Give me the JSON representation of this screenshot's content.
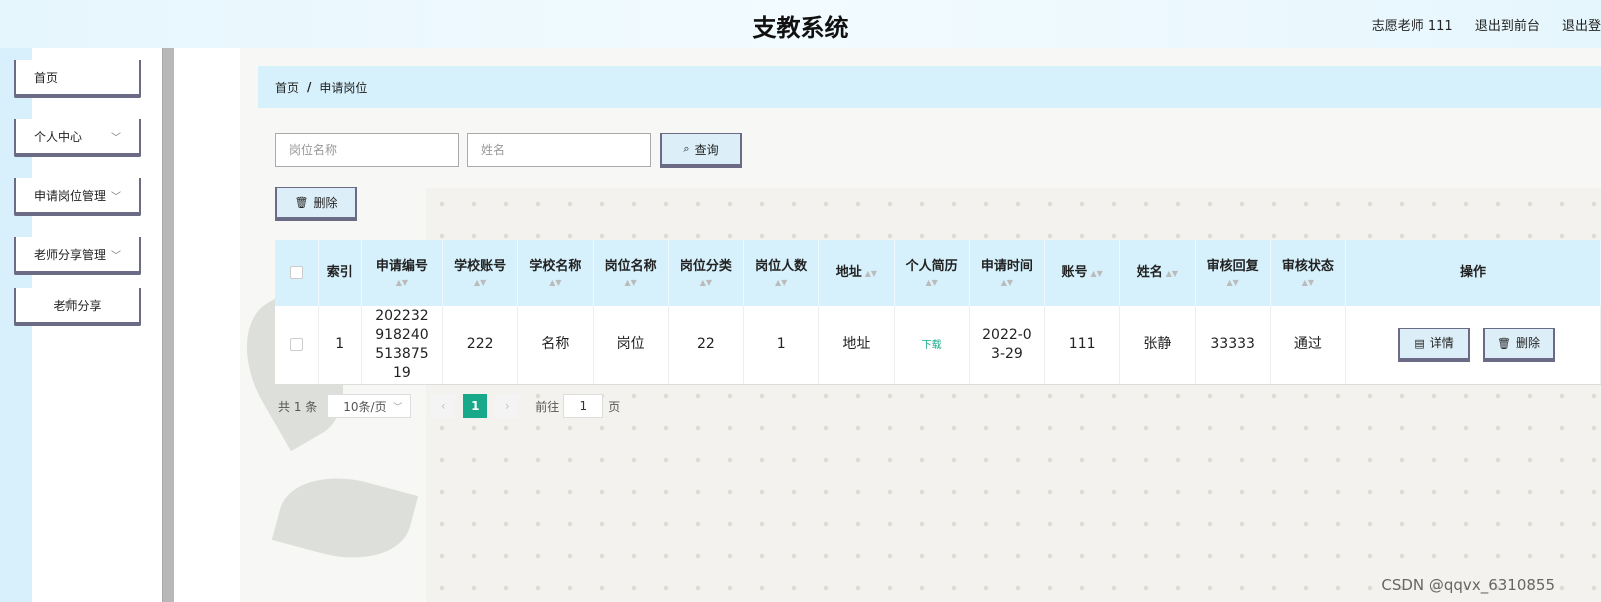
{
  "header": {
    "title": "支教系统",
    "user_label": "志愿老师 111",
    "back_to_front": "退出到前台",
    "logout": "退出登"
  },
  "sidebar": {
    "items": [
      {
        "label": "首页"
      },
      {
        "label": "个人中心"
      },
      {
        "label": "申请岗位管理"
      },
      {
        "label": "老师分享管理"
      },
      {
        "label": "老师分享"
      }
    ]
  },
  "breadcrumb": {
    "home": "首页",
    "sep": "/",
    "current": "申请岗位"
  },
  "search": {
    "position_placeholder": "岗位名称",
    "name_placeholder": "姓名",
    "query_button": "查询"
  },
  "actions": {
    "delete_button": "删除"
  },
  "table": {
    "headers": {
      "index": "索引",
      "apply_no": "申请编号",
      "school_account": "学校账号",
      "school_name": "学校名称",
      "position_name": "岗位名称",
      "position_category": "岗位分类",
      "position_count": "岗位人数",
      "address": "地址",
      "resume": "个人简历",
      "apply_time": "申请时间",
      "account": "账号",
      "name": "姓名",
      "review_reply": "审核回复",
      "review_status": "审核状态",
      "operation": "操作"
    },
    "rows": [
      {
        "index": "1",
        "apply_no": "20223291824051387519",
        "school_account": "222",
        "school_name": "名称",
        "position_name": "岗位",
        "position_category": "22",
        "position_count": "1",
        "address": "地址",
        "resume": "下载",
        "apply_time": "2022-03-29",
        "account": "111",
        "name": "张静",
        "review_reply": "33333",
        "review_status": "通过",
        "detail_button": "详情",
        "delete_button": "删除"
      }
    ]
  },
  "pagination": {
    "total": "共 1 条",
    "page_size": "10条/页",
    "current_page": "1",
    "goto_label": "前往",
    "goto_value": "1",
    "page_suffix": "页"
  },
  "watermark": "CSDN @qqvx_6310855"
}
